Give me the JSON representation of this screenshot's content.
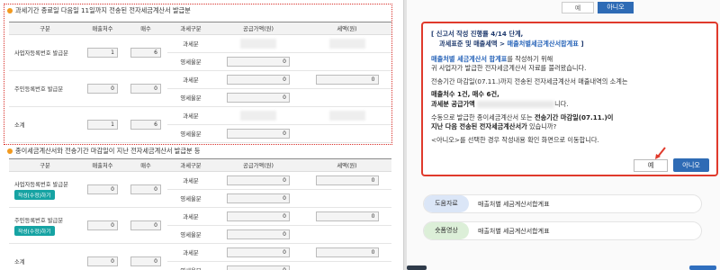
{
  "left": {
    "section1_title": "과세기간 종료일 다음일 11일까지 전송된 전자세금계산서 발급분",
    "section2_title": "종이세금계산서와 전송기간 마감일이 지난 전자세금계산서 발급분 등",
    "headers": [
      "구분",
      "매출처수",
      "매수",
      "과세구분",
      "공급가액(원)",
      "세액(원)"
    ],
    "tax_types": {
      "taxable": "과세분",
      "zero": "영세율분"
    },
    "table1": {
      "rows": [
        {
          "label": "사업자등록번호 발급분",
          "buyers": "1",
          "count": "6",
          "taxable_supply": "",
          "taxable_tax": "",
          "zero_supply": "0"
        },
        {
          "label": "주민등록번호 발급분",
          "buyers": "0",
          "count": "0",
          "taxable_supply": "0",
          "taxable_tax": "0",
          "zero_supply": "0"
        },
        {
          "label": "소계",
          "buyers": "1",
          "count": "6",
          "taxable_supply": "",
          "taxable_tax": "",
          "zero_supply": "0"
        }
      ]
    },
    "table2": {
      "rows": [
        {
          "label": "사업자등록번호 발급분",
          "button": "작성(수정)하기",
          "buyers": "0",
          "count": "0",
          "taxable_supply": "0",
          "taxable_tax": "0",
          "zero_supply": "0"
        },
        {
          "label": "주민등록번호 발급분",
          "button": "작성(수정)하기",
          "buyers": "0",
          "count": "0",
          "taxable_supply": "0",
          "taxable_tax": "0",
          "zero_supply": "0"
        },
        {
          "label": "소계",
          "button": "",
          "buyers": "0",
          "count": "0",
          "taxable_supply": "0",
          "taxable_tax": "0",
          "zero_supply": "0"
        }
      ]
    }
  },
  "right": {
    "top_yes": "예",
    "top_no": "아니오",
    "dialog": {
      "line1": "[ 신고서 작성 진행률 4/14 단계,",
      "line2_a": "과세표준 및 매출세액 > ",
      "line2_b": "매출처별세금계산서합계표",
      "line2_c": " ]",
      "line3_a": "매출처별 세금계산서 합계표",
      "line3_b": "를 작성하기 위해",
      "line4": "귀 사업자가 발급한 전자세금계산서 자료를 불러왔습니다.",
      "line5": "전송기간 마감일(07.11.)까지 전송된 전자세금계산서 매출내역의 소계는",
      "line6": "매출처수 1건, 매수 6건,",
      "line7_a": "과세분 공급가액",
      "line7_b": "니다.",
      "line8_a": "수동으로 발급한 종이세금계산서 또는 ",
      "line8_b": "전송기간 마감일(07.11.)이",
      "line9": "지난 다음 전송된 전자세금계산서가",
      "line9_b": " 있습니까?",
      "line10": "<아니오>를 선택한 경우 작성내용 확인 화면으로 이동합니다.",
      "yes": "예",
      "no": "아니오"
    },
    "refs": [
      {
        "tag": "도움자료",
        "text": "매출처별 세금계산서합계표",
        "color": "#dbe6f7"
      },
      {
        "tag": "숏폼영상",
        "text": "매출처별 세금계산서합계표",
        "color": "#dcefd8"
      }
    ]
  },
  "colors": {
    "accent_blue": "#2e6bb5",
    "alert_red": "#e03a2c",
    "teal_button": "#16a3a3"
  }
}
